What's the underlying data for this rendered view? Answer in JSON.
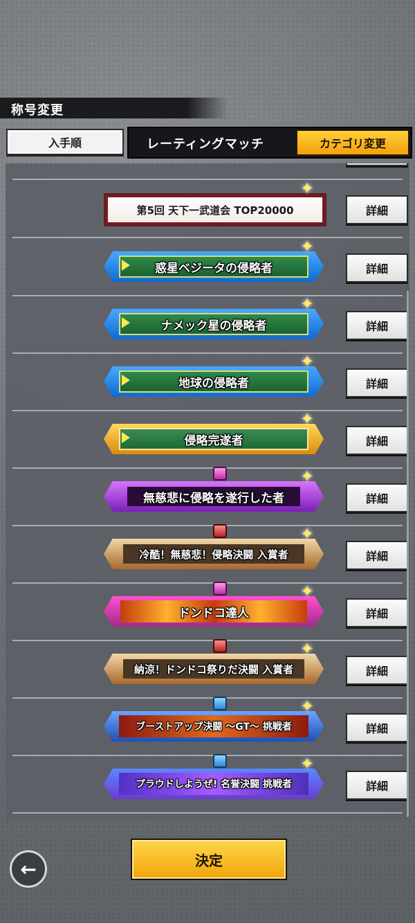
{
  "header": {
    "title": "称号変更",
    "sort_label": "入手順",
    "category_tab": "レーティングマッチ",
    "change_category_label": "カテゴリ変更"
  },
  "titles": [
    {
      "label": "第5回 天下一武道会 TOP20000",
      "detail_label": "詳細"
    },
    {
      "label": "惑星ベジータの侵略者",
      "detail_label": "詳細"
    },
    {
      "label": "ナメック星の侵略者",
      "detail_label": "詳細"
    },
    {
      "label": "地球の侵略者",
      "detail_label": "詳細"
    },
    {
      "label": "侵略完遂者",
      "detail_label": "詳細"
    },
    {
      "label": "無慈悲に侵略を遂行した者",
      "detail_label": "詳細"
    },
    {
      "label": "冷酷！無慈悲！侵略決闘 入賞者",
      "detail_label": "詳細"
    },
    {
      "label": "ドンドコ達人",
      "detail_label": "詳細"
    },
    {
      "label": "納涼！ドンドコ祭りだ決闘 入賞者",
      "detail_label": "詳細"
    },
    {
      "label": "ブーストアップ決闘 ～GT～ 挑戦者",
      "detail_label": "詳細"
    },
    {
      "label": "プラウドしようぜ! 名誉決闘 挑戦者",
      "detail_label": "詳細"
    }
  ],
  "footer": {
    "decide_label": "決定",
    "back_icon": "arrow-left-icon"
  },
  "colors": {
    "accent": "#f7b21d",
    "dark": "#15171d"
  }
}
